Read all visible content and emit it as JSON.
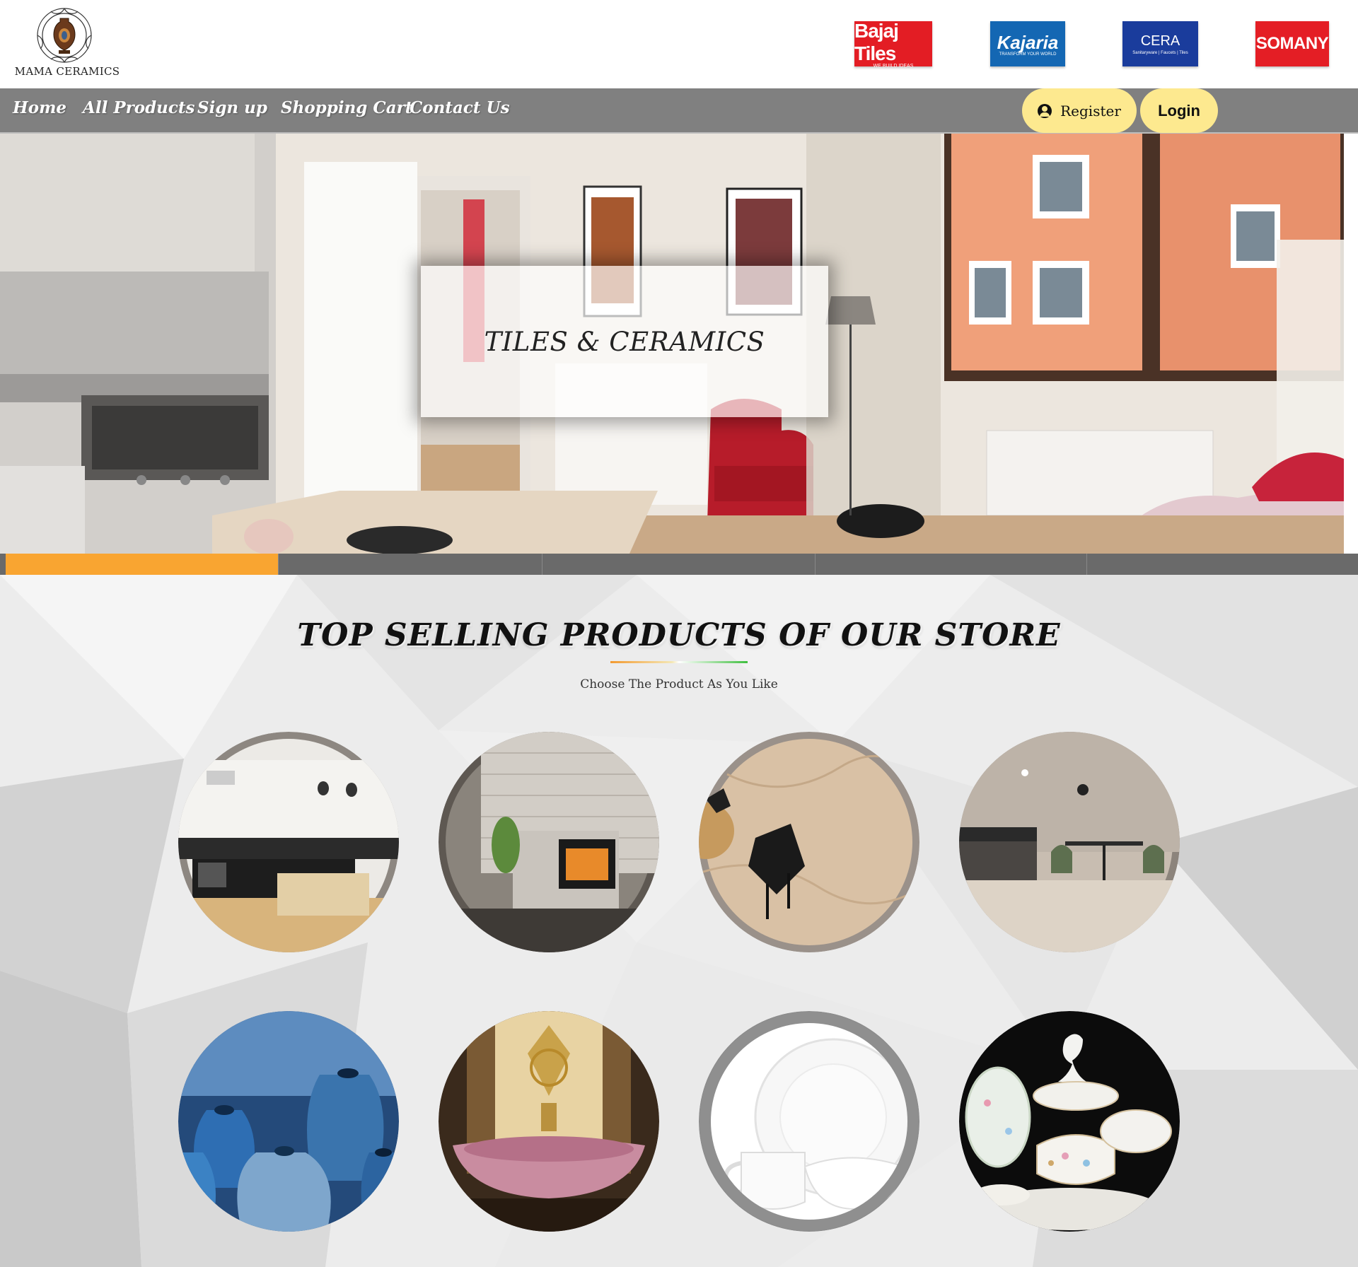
{
  "header": {
    "logo_text": "MAMA CERAMICS",
    "brands": [
      {
        "name": "Bajaj Tiles",
        "tagline": "WE BUILD IDEAS",
        "color": "#e31d24"
      },
      {
        "name": "Kajaria",
        "tagline": "TRANSFORM YOUR WORLD",
        "color": "#1467b3"
      },
      {
        "name": "CERA",
        "tagline": "Sanitaryware | Faucets | Tiles",
        "color": "#1a3c9c"
      },
      {
        "name": "SOMANY",
        "color": "#e41e25"
      }
    ]
  },
  "nav": {
    "items": [
      "Home",
      "All Products",
      "Sign up",
      "Shopping Cart",
      "Contact Us"
    ],
    "register_label": "Register",
    "login_label": "Login",
    "register_icon": "user-circle-icon",
    "bar_color": "#808080",
    "button_color": "#fde98f"
  },
  "hero": {
    "caption": "TILES & CERAMICS",
    "slides_total": 5,
    "active_slide": 1,
    "active_color": "#f9a531"
  },
  "products": {
    "title": "TOP SELLING PRODUCTS OF OUR STORE",
    "subtitle": "Choose The Product As You Like",
    "items": [
      {
        "image": "kitchen-interior"
      },
      {
        "image": "stone-wall-fireplace"
      },
      {
        "image": "marble-floor-tiles"
      },
      {
        "image": "dining-room-floor"
      },
      {
        "image": "blue-ceramic-vases"
      },
      {
        "image": "pink-stone-basin"
      },
      {
        "image": "white-plates-and-cups"
      },
      {
        "image": "floral-dinner-set"
      }
    ]
  }
}
